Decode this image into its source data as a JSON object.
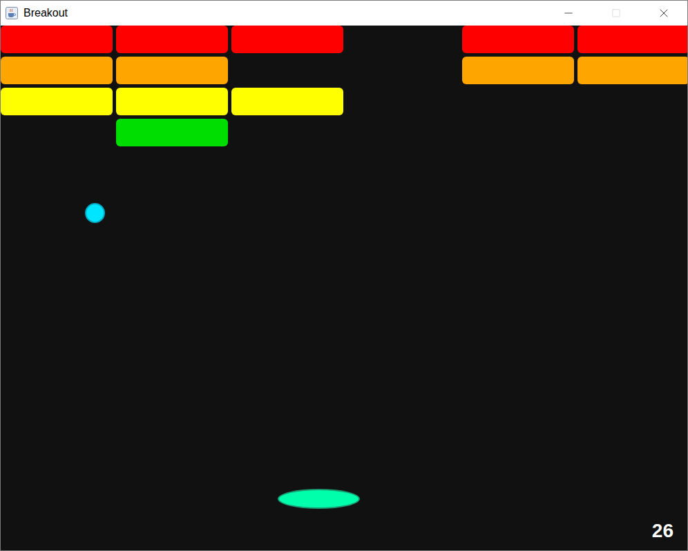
{
  "window": {
    "title": "Breakout"
  },
  "controls": [
    {
      "kind": "minimize",
      "disabled": false
    },
    {
      "kind": "maximize",
      "disabled": true
    },
    {
      "kind": "close",
      "disabled": false
    }
  ],
  "brick_rows": [
    {
      "color": "#ff0000",
      "bricks": [
        {
          "intact": true
        },
        {
          "intact": true
        },
        {
          "intact": true
        },
        {
          "intact": false
        },
        {
          "intact": true
        },
        {
          "intact": true
        }
      ]
    },
    {
      "color": "#ffa500",
      "bricks": [
        {
          "intact": true
        },
        {
          "intact": true
        },
        {
          "intact": false
        },
        {
          "intact": false
        },
        {
          "intact": true
        },
        {
          "intact": true
        }
      ]
    },
    {
      "color": "#ffff00",
      "bricks": [
        {
          "intact": true
        },
        {
          "intact": true
        },
        {
          "intact": true
        },
        {
          "intact": false
        },
        {
          "intact": false
        },
        {
          "intact": false
        }
      ]
    },
    {
      "color": "#00dd00",
      "bricks": [
        {
          "intact": false
        },
        {
          "intact": true
        },
        {
          "intact": false
        },
        {
          "intact": false
        },
        {
          "intact": false
        },
        {
          "intact": false
        }
      ]
    }
  ],
  "score": "26"
}
